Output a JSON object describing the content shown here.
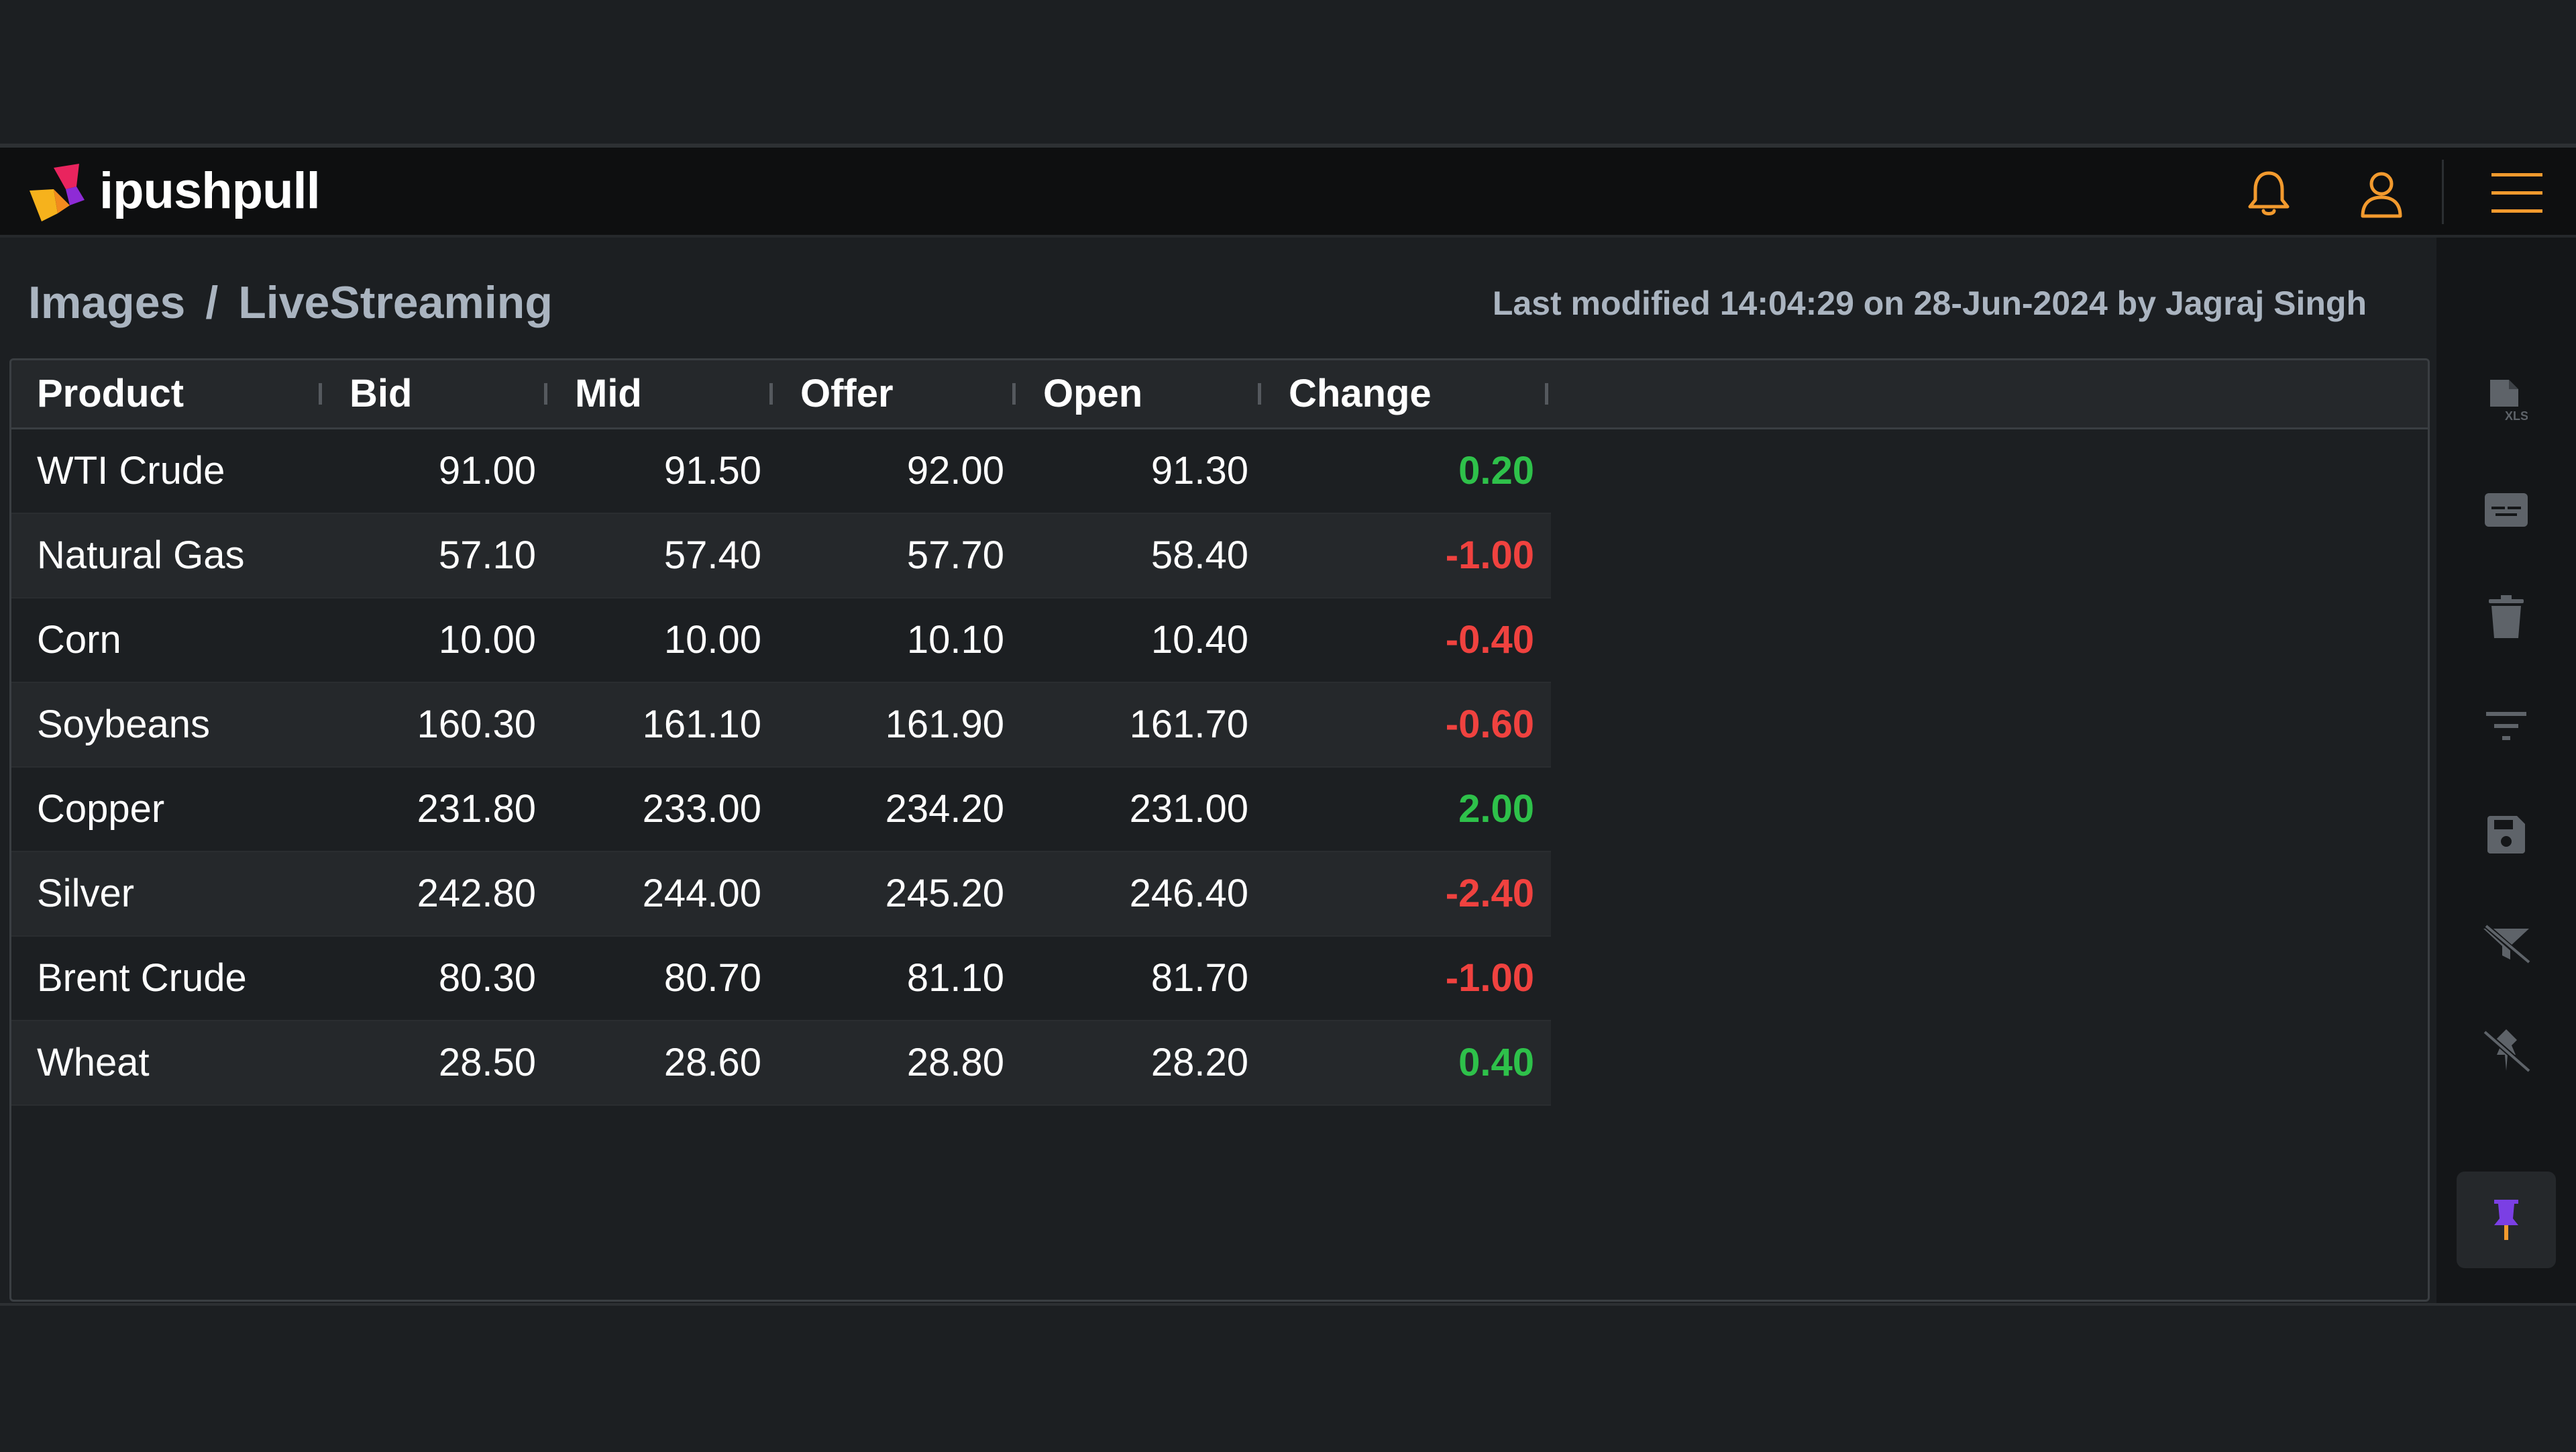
{
  "app": {
    "brand": "ipushpull"
  },
  "breadcrumb": {
    "folder": "Images",
    "separator": "/",
    "page": "LiveStreaming"
  },
  "meta": {
    "last_modified": "Last modified 14:04:29 on 28-Jun-2024 by Jagraj Singh"
  },
  "table": {
    "columns": [
      "Product",
      "Bid",
      "Mid",
      "Offer",
      "Open",
      "Change"
    ],
    "rows": [
      {
        "product": "WTI Crude",
        "bid": "91.00",
        "mid": "91.50",
        "offer": "92.00",
        "open": "91.30",
        "change": "0.20",
        "direction": "up"
      },
      {
        "product": "Natural Gas",
        "bid": "57.10",
        "mid": "57.40",
        "offer": "57.70",
        "open": "58.40",
        "change": "-1.00",
        "direction": "down"
      },
      {
        "product": "Corn",
        "bid": "10.00",
        "mid": "10.00",
        "offer": "10.10",
        "open": "10.40",
        "change": "-0.40",
        "direction": "down"
      },
      {
        "product": "Soybeans",
        "bid": "160.30",
        "mid": "161.10",
        "offer": "161.90",
        "open": "161.70",
        "change": "-0.60",
        "direction": "down"
      },
      {
        "product": "Copper",
        "bid": "231.80",
        "mid": "233.00",
        "offer": "234.20",
        "open": "231.00",
        "change": "2.00",
        "direction": "up"
      },
      {
        "product": "Silver",
        "bid": "242.80",
        "mid": "244.00",
        "offer": "245.20",
        "open": "246.40",
        "change": "-2.40",
        "direction": "down"
      },
      {
        "product": "Brent Crude",
        "bid": "80.30",
        "mid": "80.70",
        "offer": "81.10",
        "open": "81.70",
        "change": "-1.00",
        "direction": "down"
      },
      {
        "product": "Wheat",
        "bid": "28.50",
        "mid": "28.60",
        "offer": "28.80",
        "open": "28.20",
        "change": "0.40",
        "direction": "up"
      }
    ]
  },
  "toolbar_icons": [
    "export-xls-icon",
    "keyboard-icon",
    "trash-icon",
    "filter-icon",
    "save-icon",
    "filter-off-icon",
    "unpin-icon"
  ],
  "header_icons": [
    "bell-icon",
    "user-icon",
    "hamburger-menu-icon"
  ],
  "colors": {
    "accent_orange": "#f29a2e",
    "positive": "#2ec14a",
    "negative": "#f0423f",
    "pin_purple": "#7b3fe4"
  }
}
